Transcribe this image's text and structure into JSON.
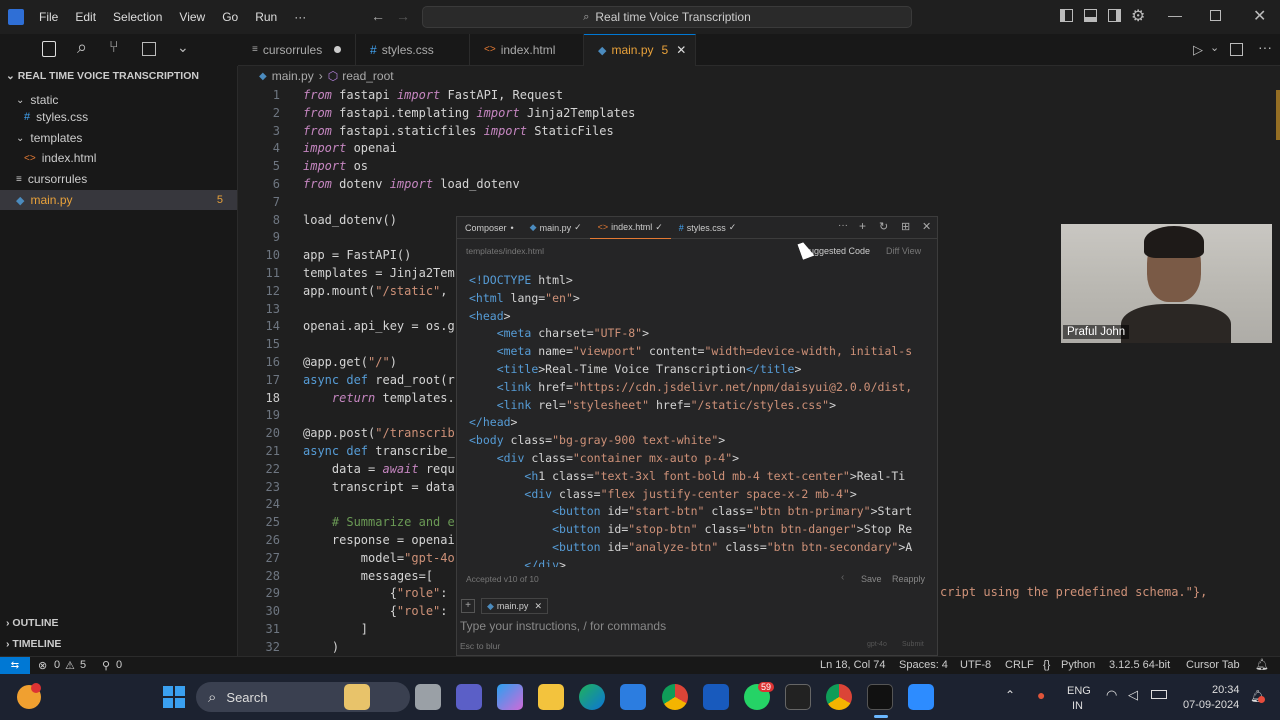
{
  "menu": {
    "items": [
      "File",
      "Edit",
      "Selection",
      "View",
      "Go",
      "Run",
      "···"
    ],
    "search": "Real time Voice Transcription"
  },
  "explorer": {
    "title": "REAL TIME VOICE TRANSCRIPTION",
    "items": [
      {
        "label": "static"
      },
      {
        "label": "styles.css"
      },
      {
        "label": "templates"
      },
      {
        "label": "index.html"
      },
      {
        "label": "cursorrules"
      },
      {
        "label": "main.py",
        "badge": "5"
      }
    ],
    "outline": "OUTLINE",
    "timeline": "TIMELINE"
  },
  "tabs": [
    {
      "label": "cursorrules"
    },
    {
      "label": "styles.css"
    },
    {
      "label": "index.html"
    },
    {
      "label": "main.py",
      "badge": "5"
    }
  ],
  "breadcrumb": {
    "file": "main.py",
    "symbol": "read_root"
  },
  "code": {
    "line_numbers": [
      "1",
      "2",
      "3",
      "4",
      "5",
      "6",
      "7",
      "8",
      "9",
      "10",
      "11",
      "12",
      "13",
      "14",
      "15",
      "16",
      "17",
      "18",
      "19",
      "20",
      "21",
      "22",
      "23",
      "24",
      "25",
      "26",
      "27",
      "28",
      "29",
      "30",
      "31",
      "32"
    ],
    "lines": [
      "from fastapi import FastAPI, Request",
      "from fastapi.templating import Jinja2Templates",
      "from fastapi.staticfiles import StaticFiles",
      "import openai",
      "import os",
      "from dotenv import load_dotenv",
      "",
      "load_dotenv()",
      "",
      "app = FastAPI()",
      "templates = Jinja2Tem",
      "app.mount(\"/static\",",
      "",
      "openai.api_key = os.g",
      "",
      "@app.get(\"/\")",
      "async def read_root(r",
      "    return templates.",
      "",
      "@app.post(\"/transcrib",
      "async def transcribe_",
      "    data = await requ",
      "    transcript = data",
      "",
      "    # Summarize and e",
      "    response = openai",
      "        model=\"gpt-4o",
      "        messages=[",
      "            {\"role\":",
      "            {\"role\":",
      "        ]",
      "    )"
    ],
    "line29_tail": "cript using the predefined schema.\"},"
  },
  "composer": {
    "tabs": [
      "Composer",
      "main.py",
      "index.html",
      "styles.css"
    ],
    "path": "templates/index.html",
    "suggested": "Suggested Code",
    "diff": "Diff View",
    "lines": [
      "<!DOCTYPE html>",
      "<html lang=\"en\">",
      "<head>",
      "    <meta charset=\"UTF-8\">",
      "    <meta name=\"viewport\" content=\"width=device-width, initial-s",
      "    <title>Real-Time Voice Transcription</title>",
      "    <link href=\"https://cdn.jsdelivr.net/npm/daisyui@2.0.0/dist,",
      "    <link rel=\"stylesheet\" href=\"/static/styles.css\">",
      "</head>",
      "<body class=\"bg-gray-900 text-white\">",
      "    <div class=\"container mx-auto p-4\">",
      "        <h1 class=\"text-3xl font-bold mb-4 text-center\">Real-Ti",
      "        <div class=\"flex justify-center space-x-2 mb-4\">",
      "            <button id=\"start-btn\" class=\"btn btn-primary\">Start",
      "            <button id=\"stop-btn\" class=\"btn btn-danger\">Stop Re",
      "            <button id=\"analyze-btn\" class=\"btn btn-secondary\">A",
      "        </div>"
    ],
    "accepted": "Accepted v10 of 10",
    "save": "Save",
    "reapply": "Reapply",
    "chip": "main.py",
    "placeholder": "Type your instructions, / for commands",
    "hint": "Esc to blur",
    "model": "gpt-4o",
    "submit": "Submit"
  },
  "webcam": {
    "name": "Praful John"
  },
  "status": {
    "problems": "0",
    "warnings": "5",
    "ports": "0",
    "position": "Ln 18, Col 74",
    "spaces": "Spaces: 4",
    "encoding": "UTF-8",
    "eol": "CRLF",
    "language": "Python",
    "version": "3.12.5 64-bit",
    "cursor_tab": "Cursor Tab"
  },
  "taskbar": {
    "search": "Search",
    "lang": "ENG",
    "region": "IN",
    "time": "20:34",
    "date": "07-09-2024",
    "badge1": "59"
  }
}
